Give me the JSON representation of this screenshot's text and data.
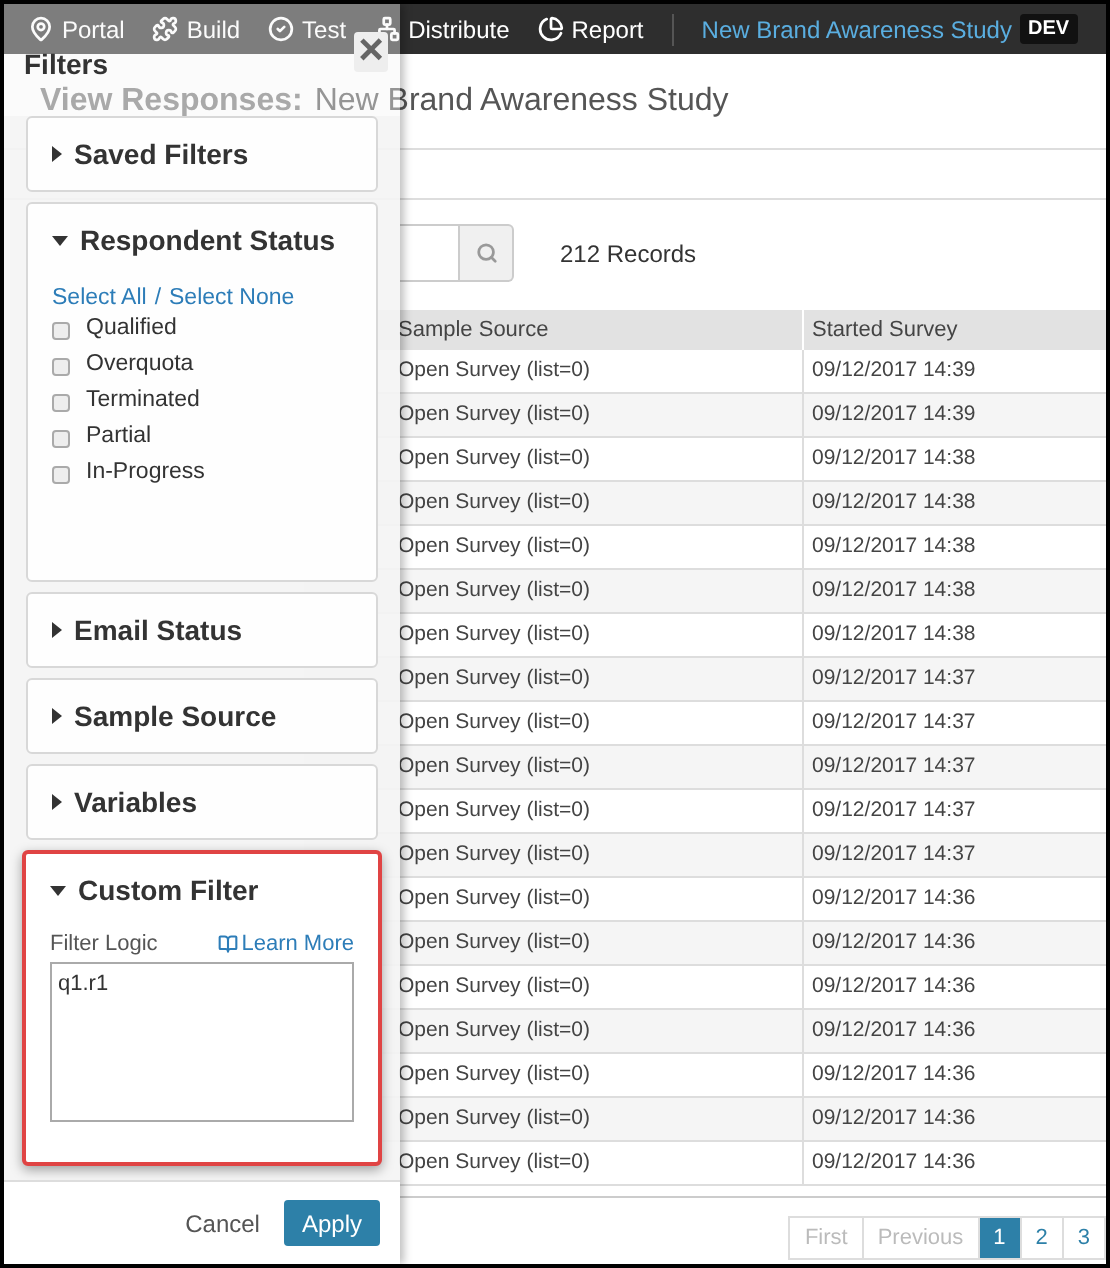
{
  "nav": {
    "items": [
      {
        "label": "Portal"
      },
      {
        "label": "Build"
      },
      {
        "label": "Test"
      },
      {
        "label": "Distribute"
      },
      {
        "label": "Report"
      }
    ],
    "project": "New Brand Awareness Study",
    "badge": "DEV"
  },
  "page": {
    "heading": "View Responses:",
    "subject": "New Brand Awareness Study",
    "records": "212 Records"
  },
  "table": {
    "columns": [
      "Sample Source",
      "Started Survey"
    ],
    "rows": [
      [
        "Open Survey (list=0)",
        "09/12/2017 14:39"
      ],
      [
        "Open Survey (list=0)",
        "09/12/2017 14:39"
      ],
      [
        "Open Survey (list=0)",
        "09/12/2017 14:38"
      ],
      [
        "Open Survey (list=0)",
        "09/12/2017 14:38"
      ],
      [
        "Open Survey (list=0)",
        "09/12/2017 14:38"
      ],
      [
        "Open Survey (list=0)",
        "09/12/2017 14:38"
      ],
      [
        "Open Survey (list=0)",
        "09/12/2017 14:38"
      ],
      [
        "Open Survey (list=0)",
        "09/12/2017 14:37"
      ],
      [
        "Open Survey (list=0)",
        "09/12/2017 14:37"
      ],
      [
        "Open Survey (list=0)",
        "09/12/2017 14:37"
      ],
      [
        "Open Survey (list=0)",
        "09/12/2017 14:37"
      ],
      [
        "Open Survey (list=0)",
        "09/12/2017 14:37"
      ],
      [
        "Open Survey (list=0)",
        "09/12/2017 14:36"
      ],
      [
        "Open Survey (list=0)",
        "09/12/2017 14:36"
      ],
      [
        "Open Survey (list=0)",
        "09/12/2017 14:36"
      ],
      [
        "Open Survey (list=0)",
        "09/12/2017 14:36"
      ],
      [
        "Open Survey (list=0)",
        "09/12/2017 14:36"
      ],
      [
        "Open Survey (list=0)",
        "09/12/2017 14:36"
      ],
      [
        "Open Survey (list=0)",
        "09/12/2017 14:36"
      ]
    ]
  },
  "pagination": [
    {
      "label": "First",
      "disabled": true,
      "selected": false
    },
    {
      "label": "Previous",
      "disabled": true,
      "selected": false
    },
    {
      "label": "1",
      "disabled": false,
      "selected": true
    },
    {
      "label": "2",
      "disabled": false,
      "selected": false
    },
    {
      "label": "3",
      "disabled": false,
      "selected": false
    }
  ],
  "filters": {
    "title": "Filters",
    "close": "×",
    "sections": [
      {
        "kind": "plain",
        "title": "Saved Filters",
        "expanded": false,
        "highlighted": false
      },
      {
        "kind": "checklist",
        "title": "Respondent Status",
        "expanded": true,
        "highlighted": false,
        "select_all": "Select All",
        "separator": "/",
        "select_none": "Select None",
        "options": [
          {
            "label": "Qualified",
            "checked": false
          },
          {
            "label": "Overquota",
            "checked": false
          },
          {
            "label": "Terminated",
            "checked": false
          },
          {
            "label": "Partial",
            "checked": false
          },
          {
            "label": "In-Progress",
            "checked": false
          }
        ]
      },
      {
        "kind": "plain",
        "title": "Email Status",
        "expanded": false,
        "highlighted": false
      },
      {
        "kind": "plain",
        "title": "Sample Source",
        "expanded": false,
        "highlighted": false
      },
      {
        "kind": "plain",
        "title": "Variables",
        "expanded": false,
        "highlighted": false
      },
      {
        "kind": "logic",
        "title": "Custom Filter",
        "expanded": true,
        "highlighted": true,
        "label": "Filter Logic",
        "link": "Learn More",
        "value": "q1.r1"
      }
    ],
    "buttons": {
      "cancel": "Cancel",
      "apply": "Apply"
    }
  }
}
